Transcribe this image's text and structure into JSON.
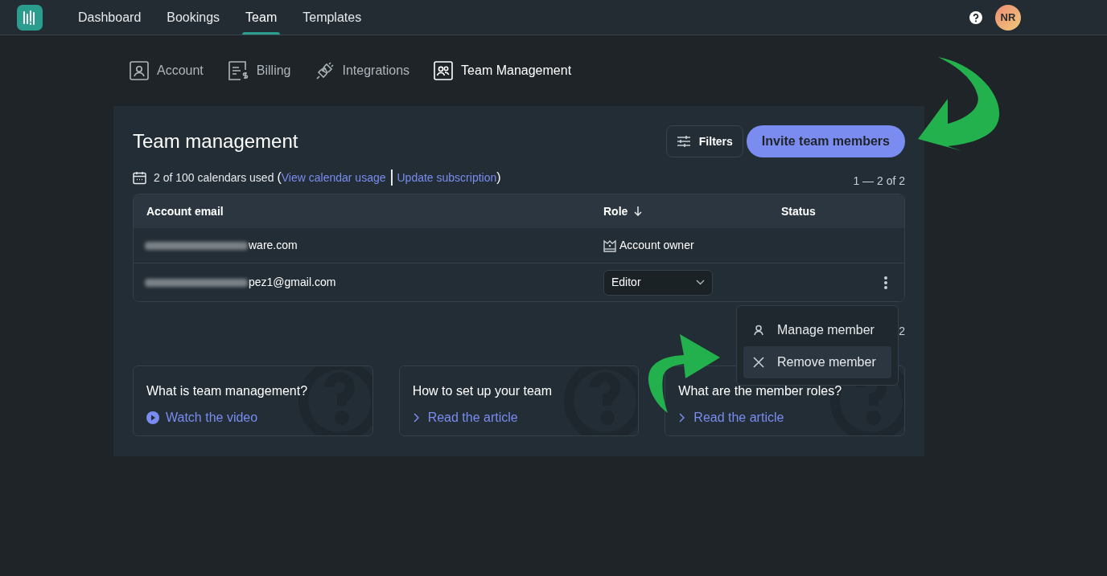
{
  "nav": {
    "items": [
      {
        "label": "Dashboard",
        "selected": false
      },
      {
        "label": "Bookings",
        "selected": false
      },
      {
        "label": "Team",
        "selected": true
      },
      {
        "label": "Templates",
        "selected": false
      }
    ],
    "avatar": "NR"
  },
  "settings_tabs": [
    {
      "label": "Account",
      "kind": "account",
      "selected": false
    },
    {
      "label": "Billing",
      "kind": "billing",
      "selected": false
    },
    {
      "label": "Integrations",
      "kind": "integrations",
      "selected": false
    },
    {
      "label": "Team Management",
      "kind": "team",
      "selected": true
    }
  ],
  "panel": {
    "title": "Team management",
    "filters_button": "Filters",
    "invite_button": "Invite team members",
    "usage": {
      "text": "2 of 100 calendars used",
      "open": "(",
      "link_1": "View calendar usage",
      "link_2": "Update subscription",
      "close": ")"
    },
    "pagination": "1 — 2 of 2",
    "table": {
      "columns": [
        {
          "label": "Account email",
          "sorted": false
        },
        {
          "label": "Role",
          "sorted": true
        },
        {
          "label": "Status",
          "sorted": false
        }
      ],
      "rows": [
        {
          "email": "ware.com",
          "kind": "owner",
          "role": "Account owner",
          "has_menu": false
        },
        {
          "email": "pez1@gmail.com",
          "kind": "select",
          "role": "Editor",
          "has_menu": true
        }
      ]
    },
    "bottom_pagination": "2",
    "row_menu": [
      {
        "label": "Manage member",
        "kind": "manage",
        "selected": false
      },
      {
        "label": "Remove member",
        "kind": "remove",
        "selected": true
      }
    ],
    "help_cards": [
      {
        "title": "What is team management?",
        "link": "Watch the video",
        "kind": "video"
      },
      {
        "title": "How to set up your team",
        "link": "Read the article",
        "kind": "article"
      },
      {
        "title": "What are the member roles?",
        "link": "Read the article",
        "kind": "article"
      }
    ]
  }
}
